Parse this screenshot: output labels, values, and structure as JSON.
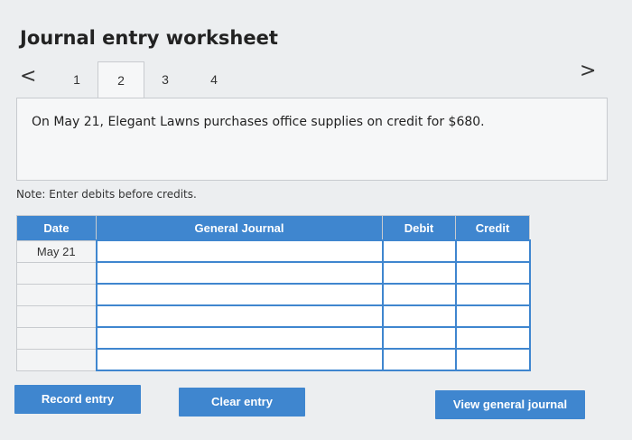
{
  "header": {
    "title": "Journal entry worksheet"
  },
  "nav": {
    "prev_glyph": "<",
    "next_glyph": ">",
    "tabs": [
      {
        "label": "1"
      },
      {
        "label": "2"
      },
      {
        "label": "3"
      },
      {
        "label": "4"
      }
    ],
    "active_tab": "2"
  },
  "prompt": {
    "text": "On May 21, Elegant Lawns purchases office supplies on credit for $680."
  },
  "note": {
    "text": "Note: Enter debits before credits."
  },
  "journal": {
    "columns": [
      "Date",
      "General Journal",
      "Debit",
      "Credit"
    ],
    "rows": [
      {
        "date": "May 21",
        "account": "",
        "debit": "",
        "credit": ""
      },
      {
        "date": "",
        "account": "",
        "debit": "",
        "credit": ""
      },
      {
        "date": "",
        "account": "",
        "debit": "",
        "credit": ""
      },
      {
        "date": "",
        "account": "",
        "debit": "",
        "credit": ""
      },
      {
        "date": "",
        "account": "",
        "debit": "",
        "credit": ""
      },
      {
        "date": "",
        "account": "",
        "debit": "",
        "credit": ""
      }
    ]
  },
  "buttons": {
    "record": "Record entry",
    "clear": "Clear entry",
    "view": "View general journal"
  },
  "colors": {
    "accent": "#3f86cf",
    "background": "#eceef0"
  }
}
